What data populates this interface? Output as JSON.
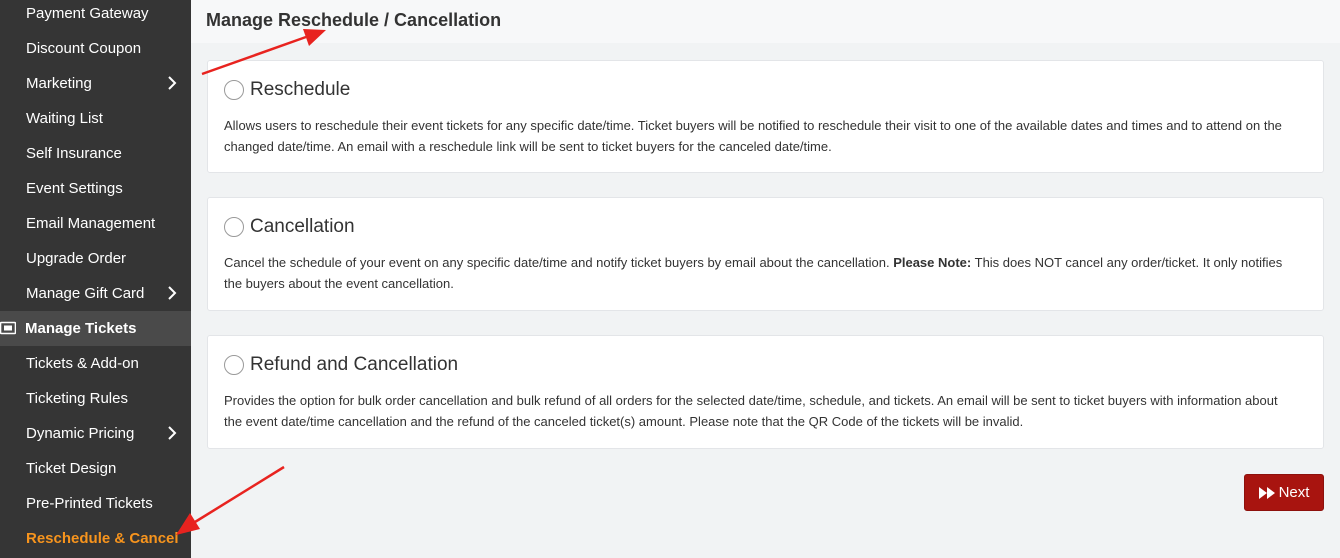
{
  "sidebar": {
    "items": [
      {
        "label": "Payment Gateway"
      },
      {
        "label": "Discount Coupon"
      },
      {
        "label": "Marketing"
      },
      {
        "label": "Waiting List"
      },
      {
        "label": "Self Insurance"
      },
      {
        "label": "Event Settings"
      },
      {
        "label": "Email Management"
      },
      {
        "label": "Upgrade Order"
      },
      {
        "label": "Manage Gift Card"
      },
      {
        "label": "Manage Tickets"
      },
      {
        "label": "Tickets & Add-on"
      },
      {
        "label": "Ticketing Rules"
      },
      {
        "label": "Dynamic Pricing"
      },
      {
        "label": "Ticket Design"
      },
      {
        "label": "Pre-Printed Tickets"
      },
      {
        "label": "Reschedule & Cancel"
      }
    ],
    "active_item": "Reschedule & Cancel",
    "section_icon": "ticket-icon",
    "expand_icon": "chevron-right-icon"
  },
  "header": {
    "title": "Manage Reschedule / Cancellation"
  },
  "options": [
    {
      "label": "Reschedule",
      "selected": false,
      "description": "Allows users to reschedule their event tickets for any specific date/time. Ticket buyers will be notified to reschedule their visit to one of the available dates and times and to attend on the changed date/time. An email with a reschedule link will be sent to ticket buyers for the canceled date/time."
    },
    {
      "label": "Cancellation",
      "selected": false,
      "description_pre": "Cancel the schedule of your event on any specific date/time and notify ticket buyers by email about the cancellation.",
      "description_note": "Please Note:",
      "description_post": "This does NOT cancel any order/ticket. It only notifies the buyers about the event cancellation."
    },
    {
      "label": "Refund and Cancellation",
      "selected": false,
      "description": "Provides the option for bulk order cancellation and bulk refund of all orders for the selected date/time, schedule, and tickets. An email will be sent to ticket buyers with information about the event date/time cancellation and the refund of the canceled ticket(s) amount. Please note that the QR Code of the tickets will be invalid."
    }
  ],
  "actions": {
    "next_label": "Next",
    "next_icon": "fast-forward-icon"
  },
  "colors": {
    "sidebar_bg": "#353535",
    "active_item": "#f7941d",
    "next_button": "#a8140f",
    "annotation_arrow": "#e8231f"
  }
}
